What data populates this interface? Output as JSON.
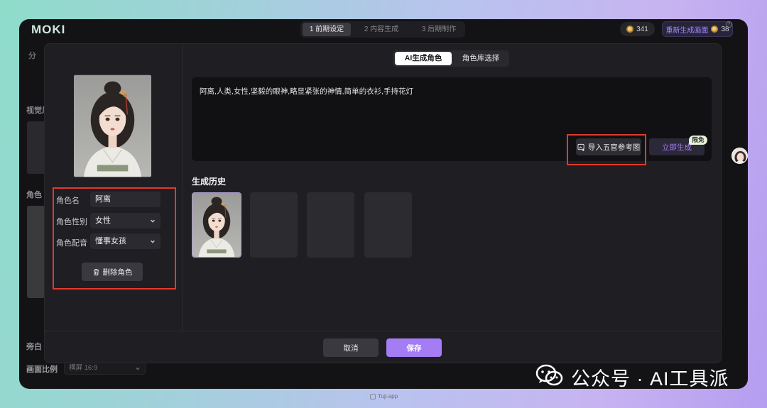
{
  "app": {
    "logo": "MOKI",
    "steps": [
      {
        "label": "1 前期设定",
        "active": true
      },
      {
        "label": "2 内容生成",
        "active": false
      },
      {
        "label": "3 后期制作",
        "active": false
      }
    ],
    "coins": "341",
    "regen_label": "重新生成画面",
    "regen_cost": "38",
    "help": "?"
  },
  "background": {
    "fragment_top": "分",
    "section_visual": "视觉风",
    "section_role": "角色",
    "section_narration": "旁白",
    "aspect_label": "画面比例",
    "aspect_value": "横屏 16:9"
  },
  "modal": {
    "left": {
      "name_label": "角色名",
      "name_value": "阿离",
      "gender_label": "角色性别",
      "gender_value": "女性",
      "voice_label": "角色配音",
      "voice_value": "懂事女孩",
      "delete_label": "删除角色"
    },
    "tabs": [
      {
        "label": "AI生成角色",
        "active": true
      },
      {
        "label": "角色库选择",
        "active": false
      }
    ],
    "prompt": "阿离,人类,女性,坚毅的眼神,略显紧张的神情,简单的衣衫,手持花灯",
    "import_label": "导入五官参考图",
    "generate_label": "立即生成",
    "generate_badge": "限免",
    "history_title": "生成历史",
    "cancel_label": "取消",
    "save_label": "保存"
  },
  "watermark": "公众号 · AI工具派",
  "source": "Tuji.app",
  "icons": [
    "coin-icon",
    "chevron-down-icon",
    "trash-icon",
    "image-import-icon",
    "wechat-icon",
    "help-icon"
  ],
  "colors": {
    "accent": "#a47cf3",
    "highlight_box": "#e3392b",
    "background_left": "#8fdccb",
    "background_right": "#b59df0"
  }
}
